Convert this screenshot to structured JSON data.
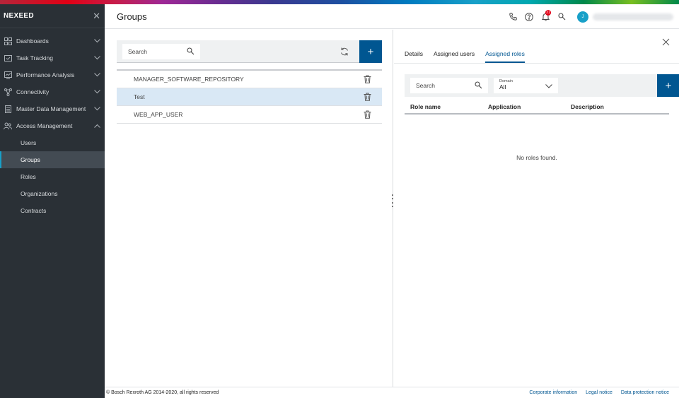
{
  "brand": {
    "name": "NEXEED"
  },
  "sidebar": {
    "items": [
      {
        "label": "Dashboards",
        "icon": "dashboard-icon"
      },
      {
        "label": "Task Tracking",
        "icon": "task-icon"
      },
      {
        "label": "Performance Analysis",
        "icon": "chart-icon"
      },
      {
        "label": "Connectivity",
        "icon": "connectivity-icon"
      },
      {
        "label": "Master Data Management",
        "icon": "database-icon"
      },
      {
        "label": "Access Management",
        "icon": "users-icon"
      }
    ],
    "sub_items": [
      "Users",
      "Groups",
      "Roles",
      "Organizations",
      "Contracts"
    ],
    "active_sub": "Groups"
  },
  "header": {
    "title": "Groups",
    "notification_count": "21",
    "avatar_initial": "J"
  },
  "groups": {
    "search_placeholder": "Search",
    "rows": [
      "MANAGER_SOFTWARE_REPOSITORY",
      "Test",
      "WEB_APP_USER"
    ],
    "selected": "Test",
    "add_label": "+"
  },
  "details": {
    "tabs": [
      "Details",
      "Assigned users",
      "Assigned roles"
    ],
    "active_tab": "Assigned roles",
    "search_placeholder": "Search",
    "domain_label": "Domain",
    "domain_value": "All",
    "add_label": "+",
    "columns": [
      "Role name",
      "Application",
      "Description"
    ],
    "empty_message": "No roles found."
  },
  "footer": {
    "copyright": "© Bosch Rexroth AG 2014-2020, all rights reserved",
    "links": [
      "Corporate information",
      "Legal notice",
      "Data protection notice"
    ]
  },
  "colors": {
    "accent": "#005691",
    "sidebar_bg": "#2a3036",
    "selected_row": "#d9e8f5"
  }
}
